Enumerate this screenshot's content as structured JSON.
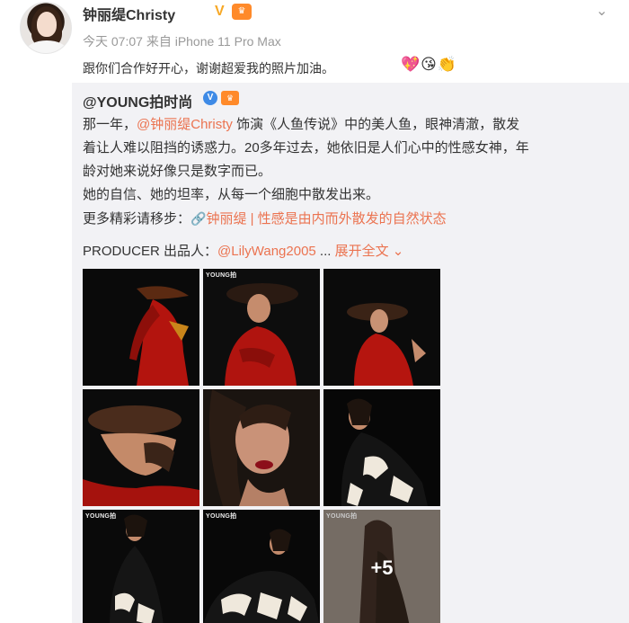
{
  "post": {
    "user_name": "钟丽缇Christy",
    "meta": "今天 07:07 来自 iPhone 11 Pro Max",
    "text": "跟你们合作好开心，谢谢超爱我的照片加油。",
    "emojis": "💖😘👏"
  },
  "retweet": {
    "author": "@YOUNG拍时尚",
    "line1_prefix": "那一年，",
    "line1_mention": "@钟丽缇Christy",
    "line1_suffix": " 饰演《人鱼传说》中的美人鱼，眼神清澈，散发",
    "line2": "着让人难以阻挡的诱惑力。20多年过去，她依旧是人们心中的性感女神，年",
    "line3": "龄对她来说好像只是数字而已。",
    "line4": "她的自信、她的坦率，从每一个细胞中散发出来。",
    "line5_prefix": "更多精彩请移步：",
    "line5_link": "钟丽缇 | 性感是由内而外散发的自然状态",
    "producer_prefix": "PRODUCER 出品人：",
    "producer_mention": "@LilyWang2005",
    "producer_sep": " ...",
    "expand_label": "展开全文"
  },
  "gallery": {
    "logo": "YOUNG拍",
    "more_count": "+5",
    "images": [
      "red-coat-hat-back",
      "red-coat-hat-front",
      "red-coat-hat-profile",
      "hat-hand-face-closeup",
      "face-closeup-red-lips",
      "calligraphy-dress-seated",
      "calligraphy-dress-standing",
      "calligraphy-dress-lying",
      "long-hair-portrait"
    ]
  },
  "icons": {
    "verify": "verified-v-icon",
    "vip": "vip-crown-icon",
    "more": "chevron-down-icon",
    "link": "link-icon",
    "expand": "chevron-down-icon"
  },
  "colors": {
    "accent": "#eb7350",
    "verify_gold": "#f7a825",
    "verify_blue": "#3e8ae6",
    "retweet_bg": "#f2f2f5"
  }
}
